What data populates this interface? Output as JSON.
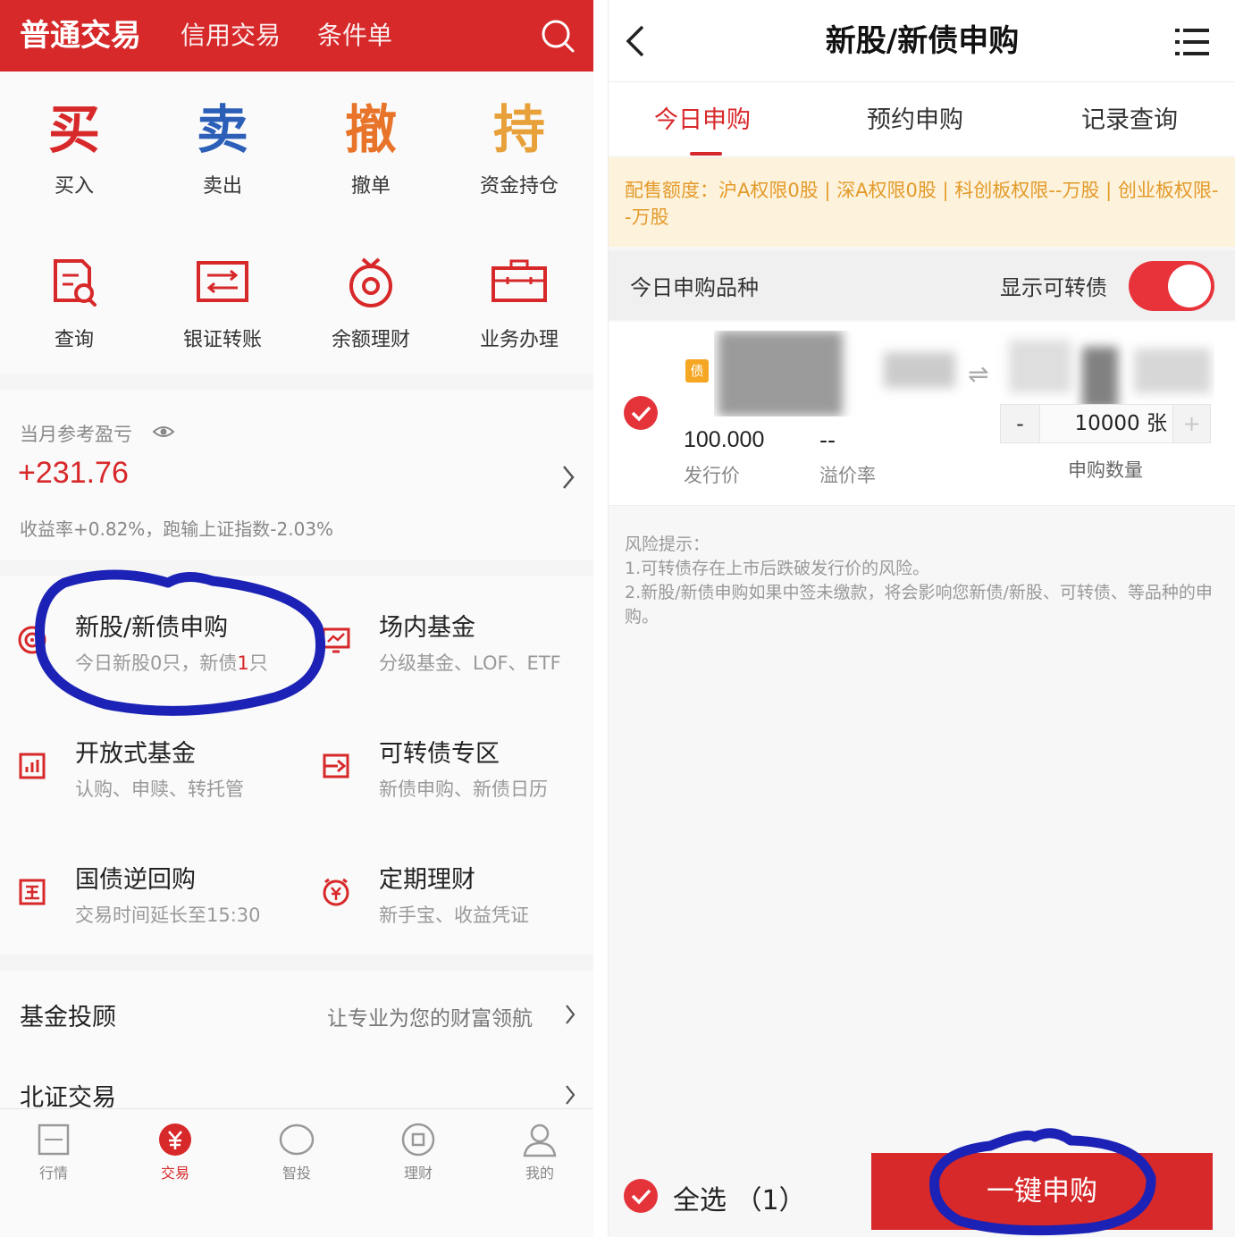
{
  "colors": {
    "brand_red": "#d7282a",
    "highlight_blue": "#1c22b5",
    "notice_orange": "#e39a2a",
    "notice_bg": "#fdf3dc"
  },
  "left": {
    "header": {
      "tabs": [
        "普通交易",
        "信用交易",
        "条件单"
      ],
      "search_icon": "search-icon"
    },
    "grid": [
      {
        "glyph": "买",
        "label": "买入",
        "color": "#d7282a"
      },
      {
        "glyph": "卖",
        "label": "卖出",
        "color": "#2c5fb8"
      },
      {
        "glyph": "撤",
        "label": "撤单",
        "color": "#e8742a"
      },
      {
        "glyph": "持",
        "label": "资金持仓",
        "color": "#e8a13a"
      },
      {
        "icon": "query-icon",
        "label": "查询"
      },
      {
        "icon": "transfer-icon",
        "label": "银证转账"
      },
      {
        "icon": "money-bag-icon",
        "label": "余额理财"
      },
      {
        "icon": "briefcase-icon",
        "label": "业务办理"
      }
    ],
    "pnl": {
      "title": "当月参考盈亏",
      "value": "+231.76",
      "desc": "收益率+0.82%，跑输上证指数-2.03%"
    },
    "services": [
      {
        "icon": "target-icon",
        "title": "新股/新债申购",
        "sub_prefix": "今日新股0只，新债",
        "sub_highlight": "1",
        "sub_suffix": "只"
      },
      {
        "icon": "chart-monitor-icon",
        "title": "场内基金",
        "sub_prefix": "分级基金、LOF、ETF",
        "sub_highlight": "",
        "sub_suffix": ""
      },
      {
        "icon": "bar-chart-icon",
        "title": "开放式基金",
        "sub_prefix": "认购、申赎、转托管",
        "sub_highlight": "",
        "sub_suffix": ""
      },
      {
        "icon": "convertible-icon",
        "title": "可转债专区",
        "sub_prefix": "新债申购、新债日历",
        "sub_highlight": "",
        "sub_suffix": ""
      },
      {
        "icon": "guo-icon",
        "title": "国债逆回购",
        "sub_prefix": "交易时间延长至15:30",
        "sub_highlight": "",
        "sub_suffix": ""
      },
      {
        "icon": "clock-yuan-icon",
        "title": "定期理财",
        "sub_prefix": "新手宝、收益凭证",
        "sub_highlight": "",
        "sub_suffix": ""
      }
    ],
    "list": [
      {
        "title": "基金投顾",
        "right": "让专业为您的财富领航"
      },
      {
        "title": "北证交易",
        "right": ""
      }
    ],
    "bottom_nav": [
      {
        "icon": "market-icon",
        "label": "行情",
        "active": false
      },
      {
        "icon": "yuan-icon",
        "label": "交易",
        "active": true
      },
      {
        "icon": "invest-icon",
        "label": "智投",
        "active": false
      },
      {
        "icon": "finance-icon",
        "label": "理财",
        "active": false
      },
      {
        "icon": "user-icon",
        "label": "我的",
        "active": false
      }
    ]
  },
  "right": {
    "header": {
      "title": "新股/新债申购",
      "back_icon": "back-arrow-icon",
      "menu_icon": "menu-list-icon"
    },
    "tabs": [
      "今日申购",
      "预约申购",
      "记录查询"
    ],
    "active_tab": 0,
    "quota": "配售额度：沪A权限0股 | 深A权限0股 | 科创板权限--万股 | 创业板权限--万股",
    "list_head": {
      "title": "今日申购品种",
      "toggle_label": "显示可转债",
      "toggle_on": true
    },
    "bond": {
      "badge": "债",
      "checked": true,
      "price": "100.000",
      "price_label": "发行价",
      "premium": "--",
      "premium_label": "溢价率",
      "minus": "-",
      "quantity": "10000 张",
      "plus": "+",
      "quantity_label": "申购数量"
    },
    "risk": {
      "title": "风险提示：",
      "lines": [
        "1.可转债存在上市后跌破发行价的风险。",
        "2.新股/新债申购如果中签未缴款，将会影响您新债/新股、可转债、等品种的申购。"
      ]
    },
    "footer": {
      "select_all": "全选 （1）",
      "button": "一键申购"
    }
  }
}
